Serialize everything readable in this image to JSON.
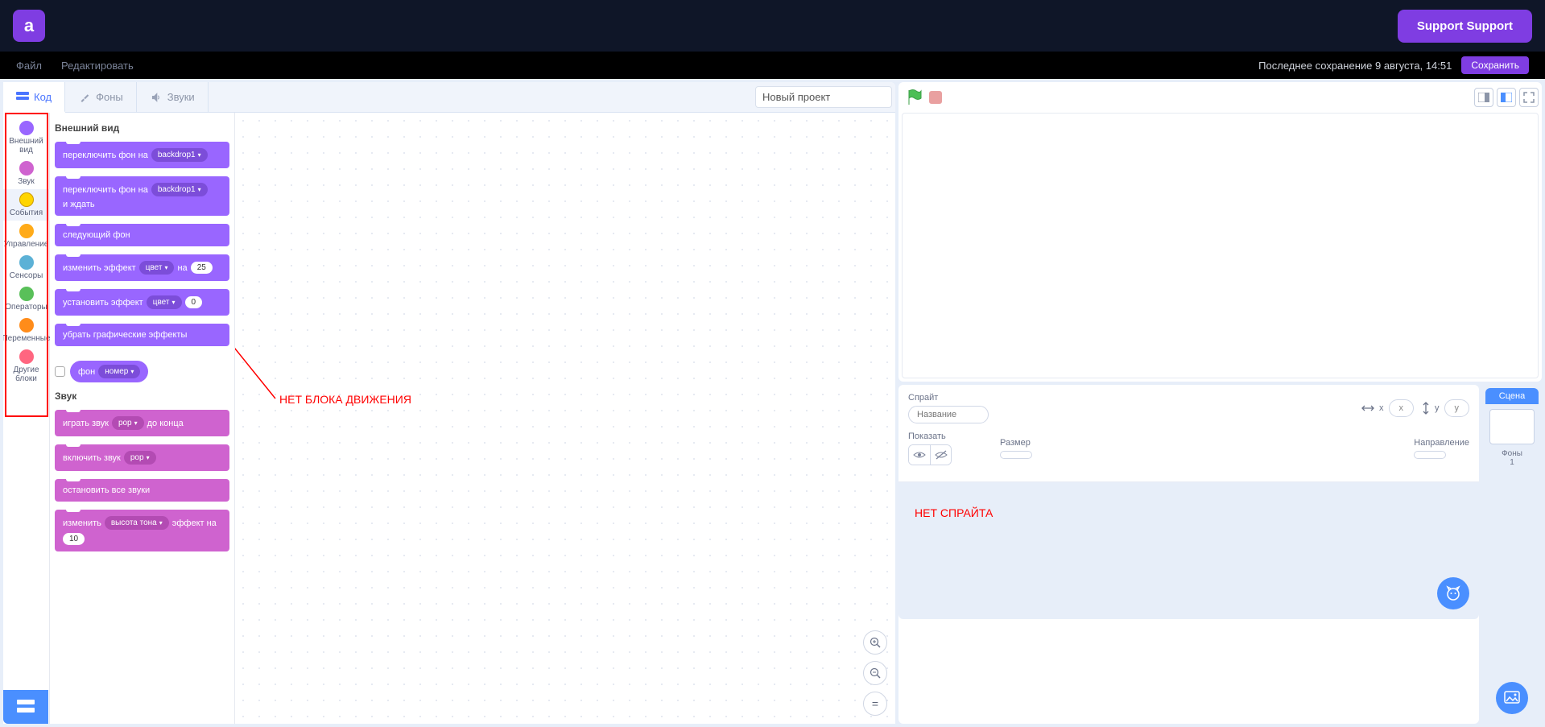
{
  "header": {
    "support_label": "Support Support",
    "logo_letter": "a"
  },
  "menubar": {
    "file": "Файл",
    "edit": "Редактировать",
    "save_status": "Последнее сохранение 9 августа, 14:51",
    "save_btn": "Сохранить"
  },
  "tabs": {
    "code": "Код",
    "costumes": "Фоны",
    "sounds": "Звуки"
  },
  "project_name": "Новый проект",
  "categories": [
    {
      "label": "Внешний вид",
      "color": "#9966ff"
    },
    {
      "label": "Звук",
      "color": "#cf63cf"
    },
    {
      "label": "События",
      "color": "#ffd500"
    },
    {
      "label": "Управление",
      "color": "#ffab19"
    },
    {
      "label": "Сенсоры",
      "color": "#5cb1d6"
    },
    {
      "label": "Операторы",
      "color": "#59c059"
    },
    {
      "label": "Переменные",
      "color": "#ff8c1a"
    },
    {
      "label": "Другие блоки",
      "color": "#ff6680"
    }
  ],
  "palette": {
    "looks_header": "Внешний вид",
    "switch_backdrop": "переключить фон на",
    "backdrop_opt": "backdrop1",
    "switch_backdrop_wait_pre": "переключить фон на",
    "switch_backdrop_wait_post": "и ждать",
    "next_backdrop": "следующий фон",
    "change_effect_pre": "изменить эффект",
    "change_effect_mid": "на",
    "color_opt": "цвет",
    "change_effect_val": "25",
    "set_effect_pre": "установить эффект",
    "set_effect_val": "0",
    "clear_effects": "убрать графические эффекты",
    "backdrop_reporter_pre": "фон",
    "backdrop_reporter_opt": "номер",
    "sound_header": "Звук",
    "play_sound_done_pre": "играть звук",
    "play_sound_done_post": "до конца",
    "sound_opt": "pop",
    "start_sound": "включить звук",
    "stop_sounds": "остановить все звуки",
    "change_pitch_pre": "изменить",
    "pitch_opt": "высота тона",
    "change_pitch_post": "эффект на",
    "change_pitch_val": "10"
  },
  "annotations": {
    "no_motion": "НЕТ БЛОКА ДВИЖЕНИЯ",
    "no_sprite": "НЕТ СПРАЙТА"
  },
  "sprite_panel": {
    "sprite_label": "Спрайт",
    "name_placeholder": "Название",
    "x_label": "x",
    "y_label": "y",
    "show_label": "Показать",
    "size_label": "Размер",
    "direction_label": "Направление"
  },
  "stage_sel": {
    "title": "Сцена",
    "backdrops_label": "Фоны",
    "backdrop_count": "1"
  }
}
